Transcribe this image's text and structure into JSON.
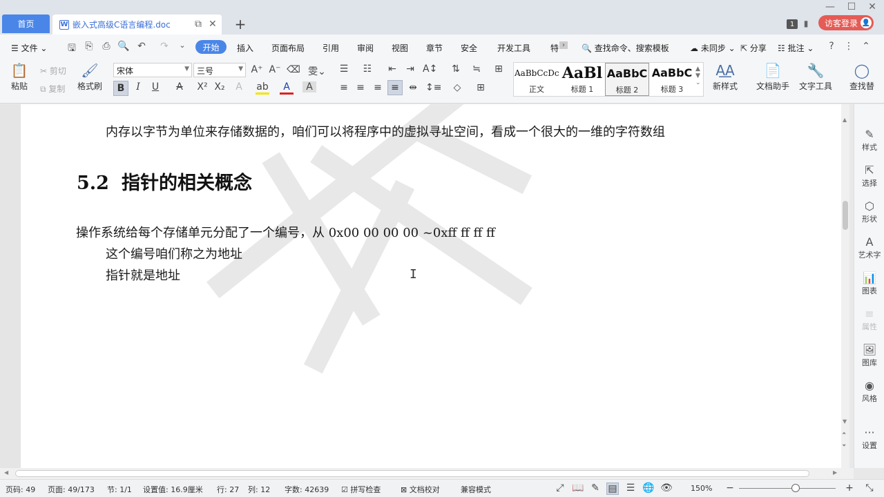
{
  "tabbar": {
    "home_label": "首页",
    "doc_title": "嵌入式高级C语言编程.doc",
    "new_tab": "+",
    "badge": "1",
    "login_label": "访客登录"
  },
  "menu": {
    "file_label": "文件",
    "items": [
      "开始",
      "插入",
      "页面布局",
      "引用",
      "审阅",
      "视图",
      "章节",
      "安全",
      "开发工具",
      "特"
    ],
    "search_label": "查找命令、搜索模板",
    "sync_label": "未同步",
    "share_label": "分享",
    "comment_label": "批注"
  },
  "ribbon": {
    "paste": "粘贴",
    "cut": "剪切",
    "copy": "复制",
    "format_painter": "格式刷",
    "font_name": "宋体",
    "font_size": "三号",
    "styles": [
      {
        "sample": "AaBbCcDc",
        "label": "正文"
      },
      {
        "sample": "AaBl",
        "label": "标题 1"
      },
      {
        "sample": "AaBbC",
        "label": "标题 2"
      },
      {
        "sample": "AaBbC",
        "label": "标题 3"
      }
    ],
    "new_style": "新样式",
    "doc_helper": "文档助手",
    "text_tools": "文字工具",
    "find_replace": "查找替"
  },
  "document": {
    "line1": "内存以字节为单位来存储数据的，咱们可以将程序中的虚拟寻址空间，看成一个很大的一维的字符数组",
    "heading_num": "5.2",
    "heading_text": "指针的相关概念",
    "line2": "操作系统给每个存储单元分配了一个编号，从 0x00 00 00 00   ~0xff ff ff ff",
    "line3": "这个编号咱们称之为地址",
    "line4": "指针就是地址"
  },
  "right_panel": {
    "items": [
      "样式",
      "选择",
      "形状",
      "艺术字",
      "图表",
      "属性",
      "图库",
      "风格",
      "设置"
    ]
  },
  "status": {
    "page_code": "页码: 49",
    "page": "页面: 49/173",
    "section": "节: 1/1",
    "setting": "设置值: 16.9厘米",
    "row": "行: 27",
    "col": "列: 12",
    "word_count": "字数: 42639",
    "spell_check": "拼写检查",
    "doc_proof": "文档校对",
    "compat": "兼容模式",
    "zoom": "150%"
  }
}
